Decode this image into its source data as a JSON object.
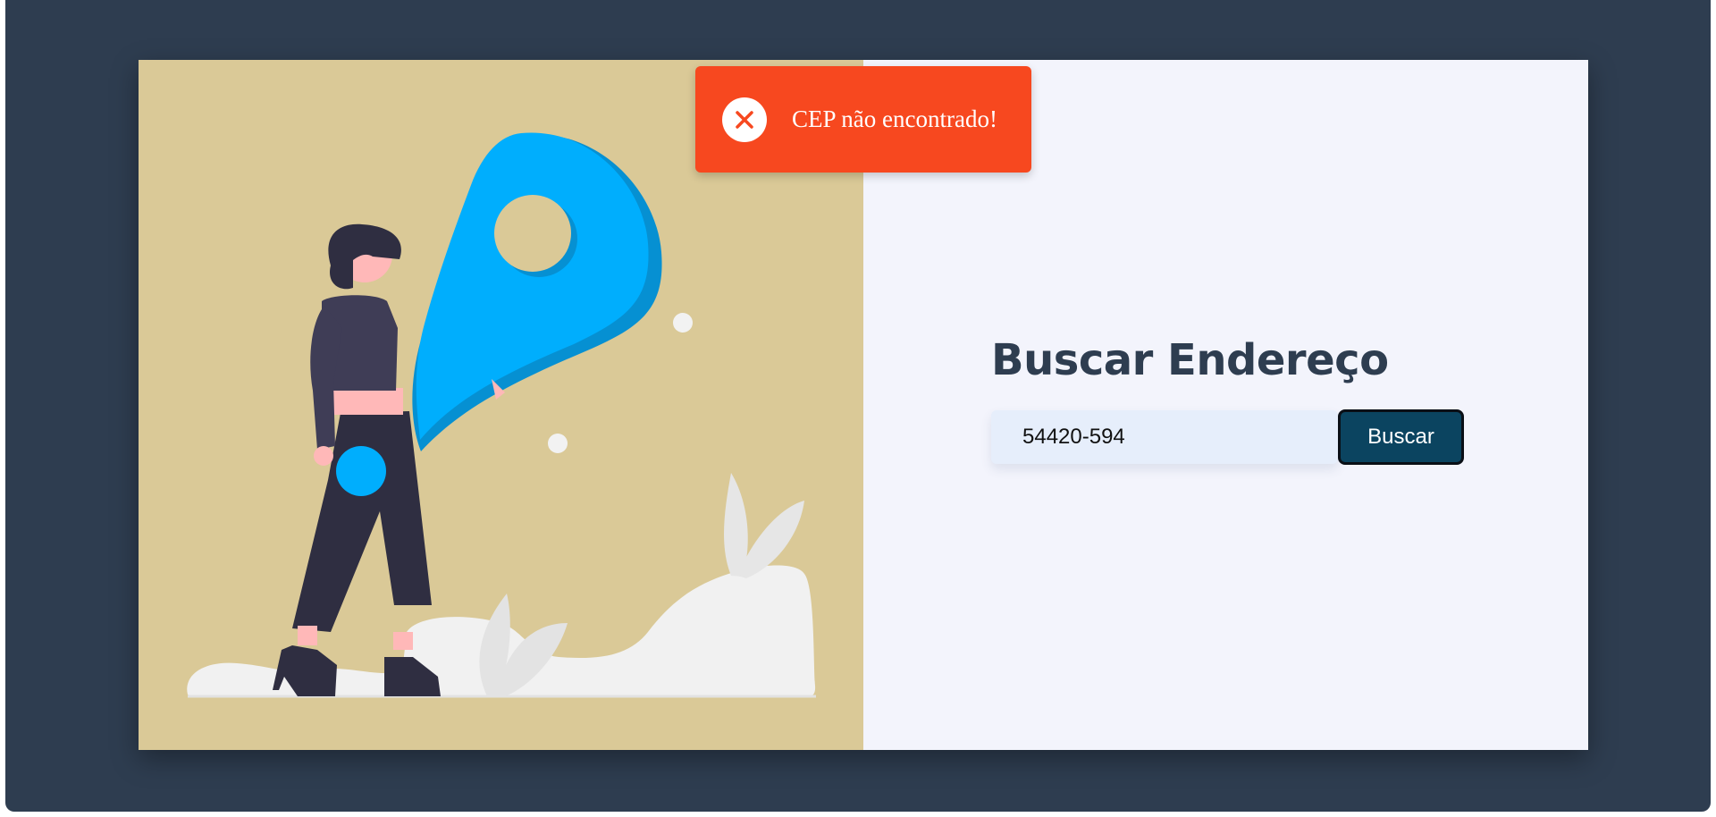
{
  "toast": {
    "message": "CEP não encontrado!",
    "icon": "close-circle-icon",
    "color": "#f7481f"
  },
  "form": {
    "title": "Buscar Endereço",
    "cep_value": "54420-594",
    "button_label": "Buscar"
  },
  "illustration": {
    "subject": "woman-with-location-pin-illustration"
  },
  "colors": {
    "frame": "#2e3d50",
    "illustration_bg": "#dac997",
    "form_bg": "#f3f4fc",
    "input_bg": "#e6eefb",
    "button": "#0b4460",
    "pin": "#00aefd"
  }
}
